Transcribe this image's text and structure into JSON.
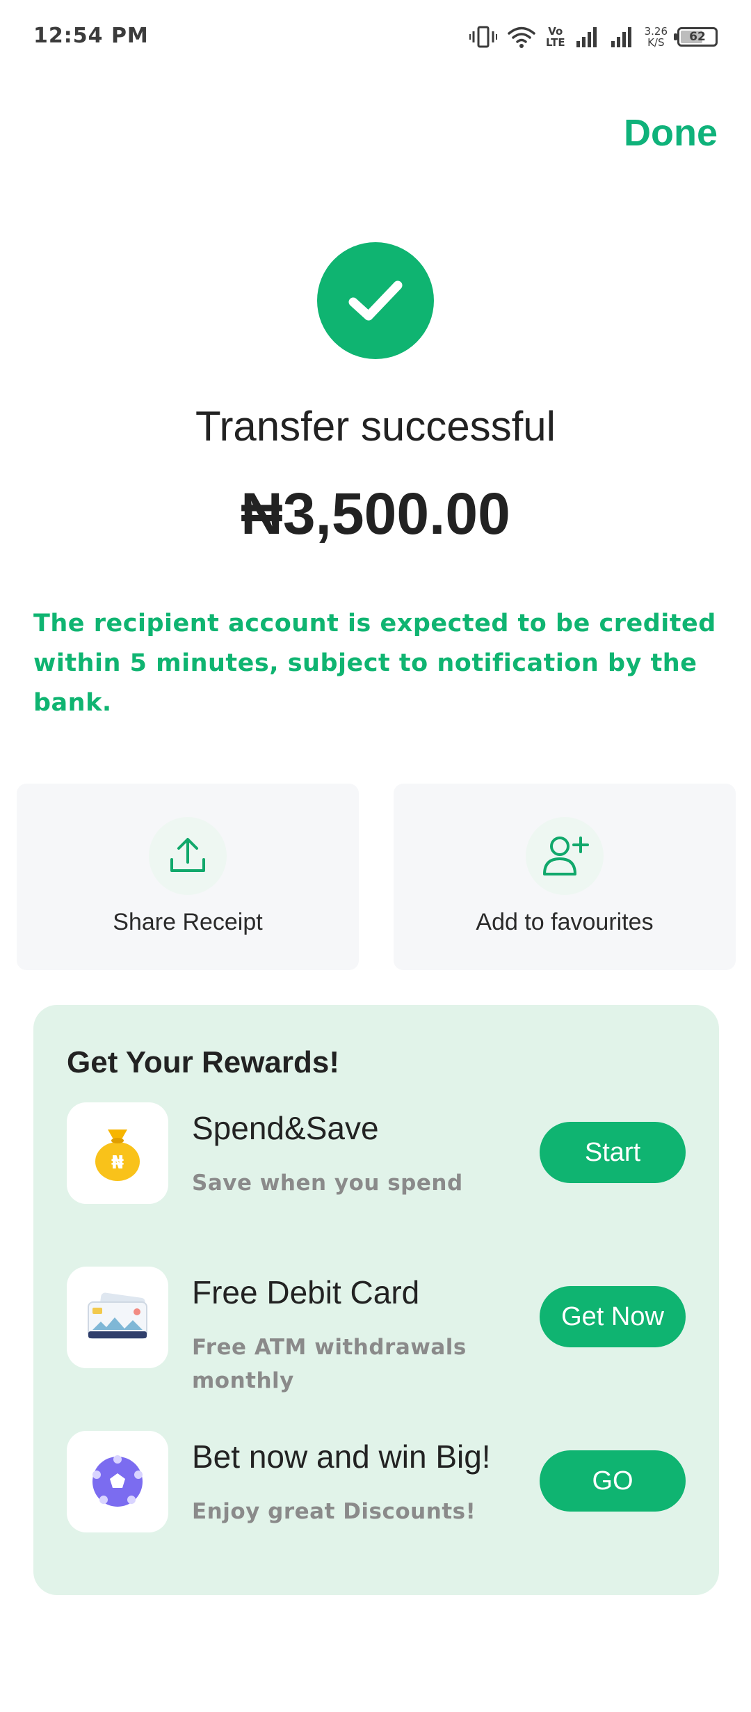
{
  "status_bar": {
    "time": "12:54 PM",
    "volte_top": "Vo",
    "volte_bottom": "LTE",
    "net_speed_value": "3.26",
    "net_speed_unit": "K/S",
    "battery_level": "62"
  },
  "header": {
    "done_label": "Done"
  },
  "result": {
    "title": "Transfer successful",
    "amount": "₦3,500.00",
    "notice": "The recipient account is expected to be credited within 5 minutes, subject to notification by the bank."
  },
  "actions": [
    {
      "label": "Share Receipt",
      "icon": "share-upload-icon"
    },
    {
      "label": "Add to favourites",
      "icon": "add-user-icon"
    }
  ],
  "rewards": {
    "title": "Get Your Rewards!",
    "items": [
      {
        "name": "Spend&Save",
        "description": "Save when you spend",
        "button": "Start",
        "icon": "money-bag-icon"
      },
      {
        "name": "Free Debit Card",
        "description": "Free ATM withdrawals monthly",
        "button": "Get Now",
        "icon": "debit-card-icon"
      },
      {
        "name": "Bet now and win Big!",
        "description": "Enjoy great Discounts!",
        "button": "GO",
        "icon": "soccer-ball-icon"
      }
    ]
  },
  "colors": {
    "accent": "#0fb471",
    "rewards_background": "#e1f3e9",
    "card_background": "#f6f7f9"
  }
}
